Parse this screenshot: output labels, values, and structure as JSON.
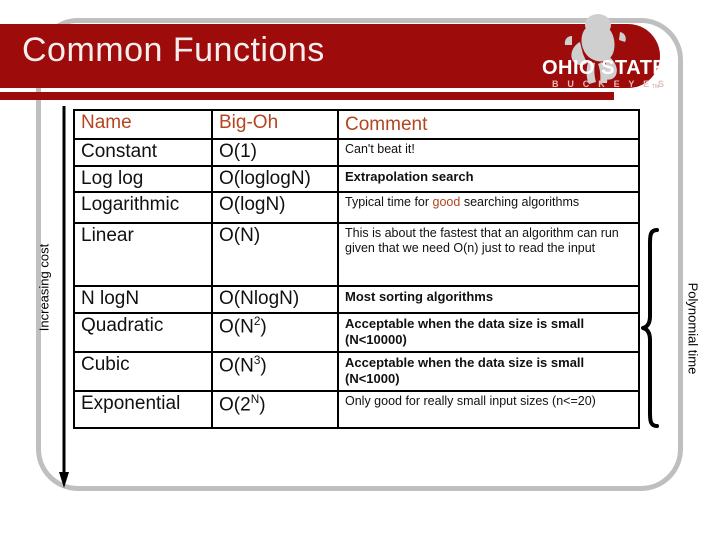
{
  "slide": {
    "title": "Common Functions",
    "banner_color": "#9e0b0b",
    "accent_color": "#b4451f"
  },
  "logo": {
    "name": "ohio-state-buckeyes-logo",
    "line1": "OHIO STATE",
    "line2": "B U C K E Y E S"
  },
  "annotations": {
    "left_axis_label": "Increasing cost",
    "right_brace_label": "Polynomial time"
  },
  "table": {
    "headers": [
      "Name",
      "Big-Oh",
      "Comment"
    ],
    "rows": [
      {
        "name": "Constant",
        "bigoh": "O(1)",
        "bigoh_sup": "",
        "comment": "Can't beat it!",
        "comment_bold": false
      },
      {
        "name": "Log log",
        "bigoh": "O(loglogN)",
        "bigoh_sup": "",
        "comment": "Extrapolation search",
        "comment_bold": true
      },
      {
        "name": "Logarithmic",
        "bigoh": "O(logN)",
        "bigoh_sup": "",
        "comment_pre": "Typical time for ",
        "comment_hl": "good",
        "comment_post": " searching algorithms",
        "comment_bold": false
      },
      {
        "name": "Linear",
        "bigoh": "O(N)",
        "bigoh_sup": "",
        "comment": "This is about the fastest that an algorithm can run given that we need O(n) just to read the input",
        "comment_bold": false
      },
      {
        "name": "N logN",
        "bigoh": "O(NlogN)",
        "bigoh_sup": "",
        "comment": "Most sorting algorithms",
        "comment_bold": true
      },
      {
        "name": "Quadratic",
        "bigoh": "O(N",
        "bigoh_sup": "2",
        "bigoh_end": ")",
        "comment": "Acceptable when the data size is small (N<10000)",
        "comment_bold": true
      },
      {
        "name": "Cubic",
        "bigoh": "O(N",
        "bigoh_sup": "3",
        "bigoh_end": ")",
        "comment": "Acceptable when the data size is small (N<1000)",
        "comment_bold": true
      },
      {
        "name": "Exponential",
        "bigoh": "O(2",
        "bigoh_sup": "N",
        "bigoh_end": ")",
        "comment": "Only good for really small input sizes (n<=20)",
        "comment_bold": false
      }
    ]
  }
}
